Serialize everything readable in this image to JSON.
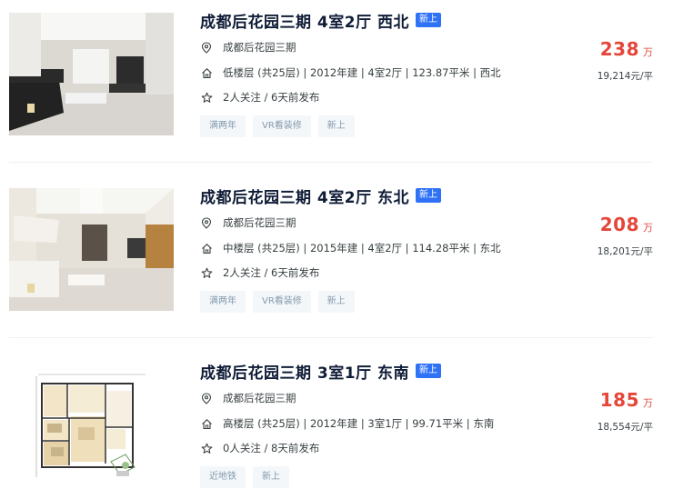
{
  "listings": [
    {
      "title": "成都后花园三期 4室2厅 西北",
      "new_badge": "新上",
      "community": "成都后花园三期",
      "house_info": "低楼层 (共25层) | 2012年建 | 4室2厅 | 123.87平米 | 西北",
      "follow_info": "2人关注 / 6天前发布",
      "tags": [
        "满两年",
        "VR看装修",
        "新上"
      ],
      "total_price": "238",
      "price_unit": "万",
      "unit_price": "19,214元/平",
      "image": "living-room-photo"
    },
    {
      "title": "成都后花园三期 4室2厅 东北",
      "new_badge": "新上",
      "community": "成都后花园三期",
      "house_info": "中楼层 (共25层) | 2015年建 | 4室2厅 | 114.28平米 | 东北",
      "follow_info": "2人关注 / 6天前发布",
      "tags": [
        "满两年",
        "VR看装修",
        "新上"
      ],
      "total_price": "208",
      "price_unit": "万",
      "unit_price": "18,201元/平",
      "image": "living-room-photo"
    },
    {
      "title": "成都后花园三期 3室1厅 东南",
      "new_badge": "新上",
      "community": "成都后花园三期",
      "house_info": "高楼层 (共25层) | 2012年建 | 3室1厅 | 99.71平米 | 东南",
      "follow_info": "0人关注 / 8天前发布",
      "tags": [
        "近地铁",
        "新上"
      ],
      "total_price": "185",
      "price_unit": "万",
      "unit_price": "18,554元/平",
      "image": "floor-plan"
    }
  ],
  "icons": {
    "location": "location-pin-icon",
    "house": "house-icon",
    "follow": "star-icon"
  },
  "colors": {
    "title": "#101d37",
    "price": "#e5463a",
    "badge": "#3072f6",
    "tag_bg": "#f4f7f9",
    "tag_text": "#849aae"
  }
}
